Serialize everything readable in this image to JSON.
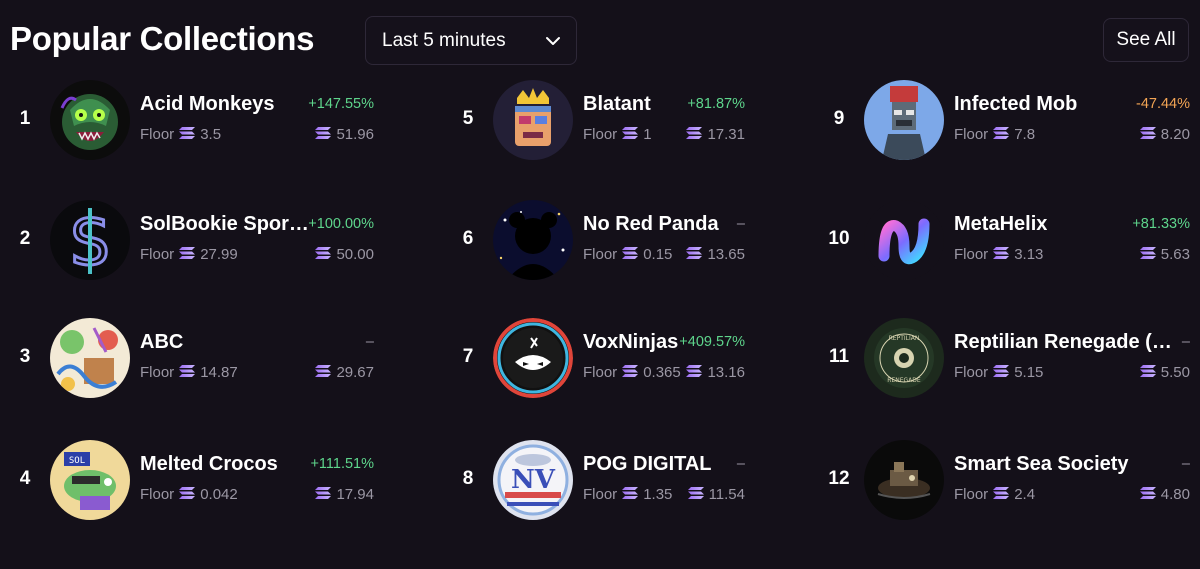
{
  "header": {
    "title": "Popular Collections",
    "timeframe": "Last 5 minutes",
    "see_all": "See All"
  },
  "floor_label": "Floor",
  "collections": [
    {
      "rank": "1",
      "name": "Acid Monkeys",
      "change": "+147.55%",
      "trend": "pos",
      "floor": "3.5",
      "volume": "51.96",
      "avatar": "acid-monkey-avatar"
    },
    {
      "rank": "2",
      "name": "SolBookie Spor…",
      "change": "+100.00%",
      "trend": "pos",
      "floor": "27.99",
      "volume": "50.00",
      "avatar": "dollar-s-avatar"
    },
    {
      "rank": "3",
      "name": "ABC",
      "change": "–",
      "trend": "none",
      "floor": "14.87",
      "volume": "29.67",
      "avatar": "abc-avatar"
    },
    {
      "rank": "4",
      "name": "Melted Crocos",
      "change": "+111.51%",
      "trend": "pos",
      "floor": "0.042",
      "volume": "17.94",
      "avatar": "croco-avatar"
    },
    {
      "rank": "5",
      "name": "Blatant",
      "change": "+81.87%",
      "trend": "pos",
      "floor": "1",
      "volume": "17.31",
      "avatar": "blatant-avatar"
    },
    {
      "rank": "6",
      "name": "No Red Panda",
      "change": "–",
      "trend": "none",
      "floor": "0.15",
      "volume": "13.65",
      "avatar": "panda-avatar"
    },
    {
      "rank": "7",
      "name": "VoxNinjas",
      "change": "+409.57%",
      "trend": "pos",
      "floor": "0.365",
      "volume": "13.16",
      "avatar": "ninja-avatar"
    },
    {
      "rank": "8",
      "name": "POG DIGITAL",
      "change": "–",
      "trend": "none",
      "floor": "1.35",
      "volume": "11.54",
      "avatar": "pog-avatar"
    },
    {
      "rank": "9",
      "name": "Infected Mob",
      "change": "-47.44%",
      "trend": "neg",
      "floor": "7.8",
      "volume": "8.20",
      "avatar": "mob-avatar"
    },
    {
      "rank": "10",
      "name": "MetaHelix",
      "change": "+81.33%",
      "trend": "pos",
      "floor": "3.13",
      "volume": "5.63",
      "avatar": "helix-avatar"
    },
    {
      "rank": "11",
      "name": "Reptilian Renegade (Li…",
      "change": "–",
      "trend": "none",
      "floor": "5.15",
      "volume": "5.50",
      "avatar": "reptilian-avatar"
    },
    {
      "rank": "12",
      "name": "Smart Sea Society",
      "change": "–",
      "trend": "none",
      "floor": "2.4",
      "volume": "4.80",
      "avatar": "sea-society-avatar"
    }
  ],
  "colors": {
    "positive": "#5ed58c",
    "negative": "#f2a454",
    "background": "#141019"
  }
}
